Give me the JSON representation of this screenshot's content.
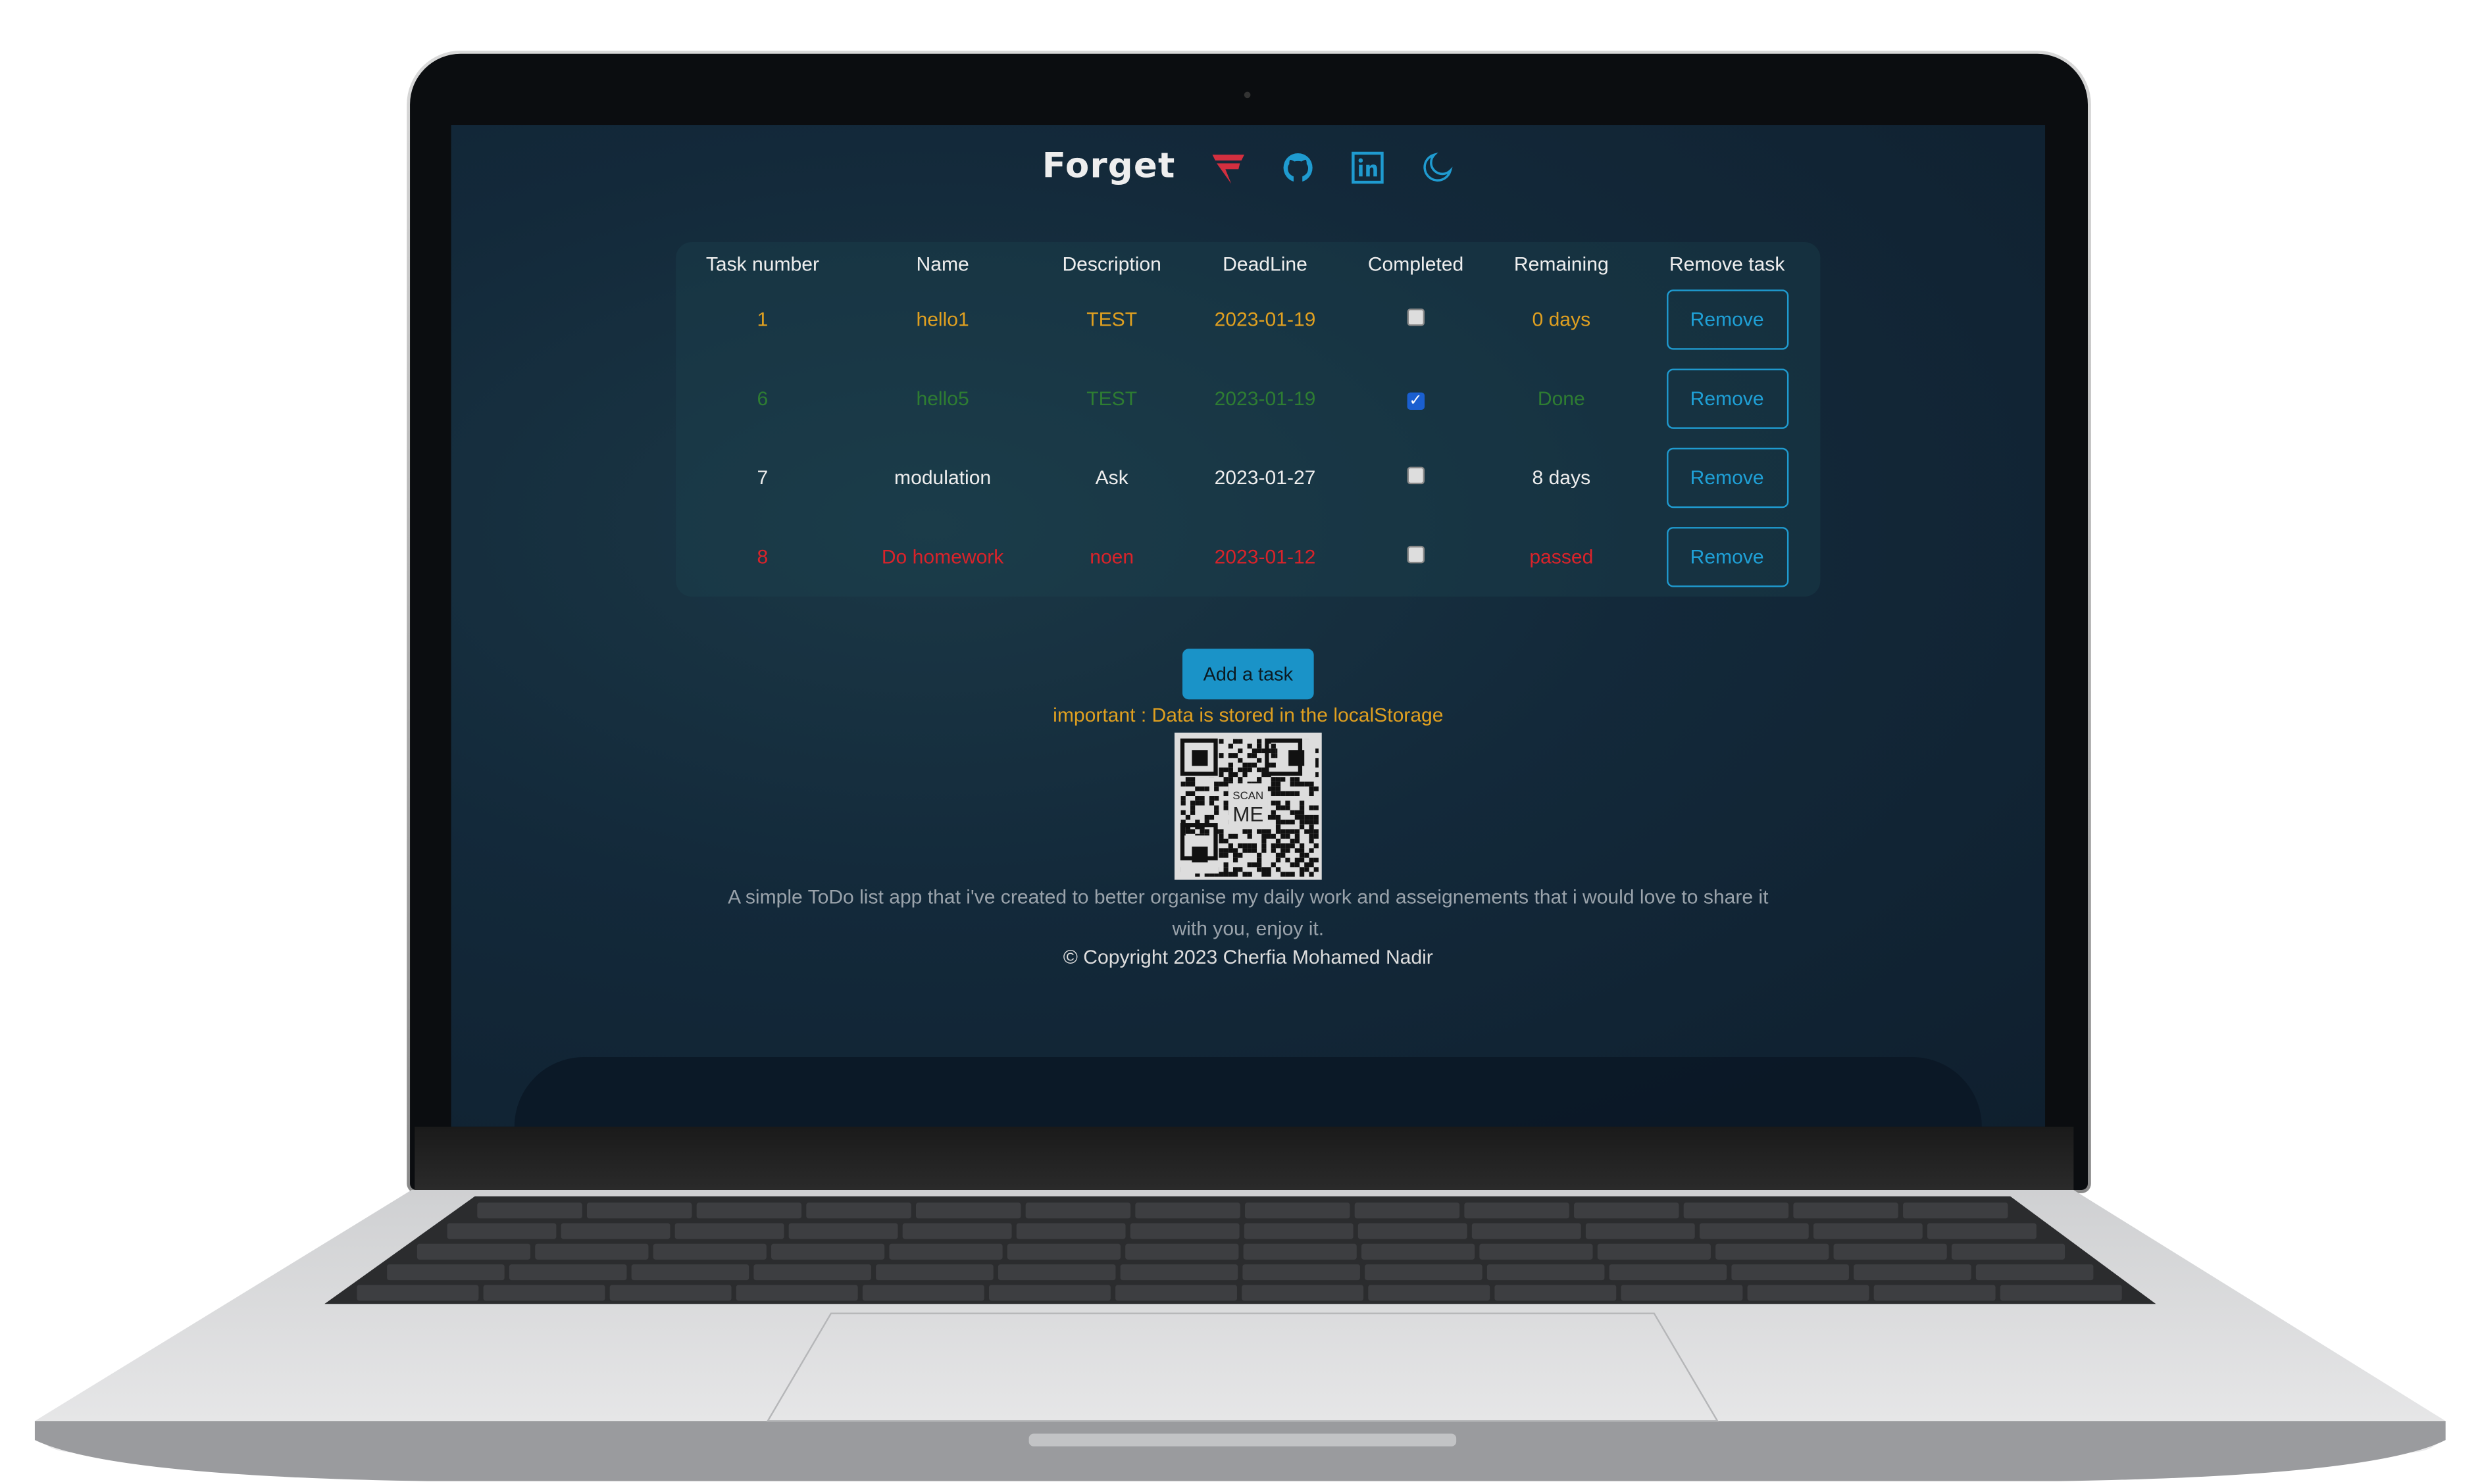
{
  "app": {
    "title": "Forget"
  },
  "header": {
    "icons": [
      "forget-logo-icon",
      "github-icon",
      "linkedin-icon",
      "moon-icon"
    ]
  },
  "table": {
    "columns": [
      "Task number",
      "Name",
      "Description",
      "DeadLine",
      "Completed",
      "Remaining",
      "Remove task"
    ],
    "rows": [
      {
        "number": "1",
        "name": "hello1",
        "description": "TEST",
        "deadline": "2023-01-19",
        "completed": false,
        "remaining": "0 days",
        "remove": "Remove",
        "color": "#e0a020"
      },
      {
        "number": "6",
        "name": "hello5",
        "description": "TEST",
        "deadline": "2023-01-19",
        "completed": true,
        "remaining": "Done",
        "remove": "Remove",
        "color": "#2e7d32"
      },
      {
        "number": "7",
        "name": "modulation",
        "description": "Ask",
        "deadline": "2023-01-27",
        "completed": false,
        "remaining": "8 days",
        "remove": "Remove",
        "color": "#eeeeee"
      },
      {
        "number": "8",
        "name": "Do homework",
        "description": "noen",
        "deadline": "2023-01-12",
        "completed": false,
        "remaining": "passed",
        "remove": "Remove",
        "color": "#d9232a"
      }
    ]
  },
  "actions": {
    "add_task": "Add a task"
  },
  "notice": "important : Data is stored in the localStorage",
  "qr": {
    "label_top": "SCAN",
    "label_bottom": "ME"
  },
  "footer": {
    "description": "A simple ToDo list app that i've created to better organise my daily work and asseignements that i would love to share it with you, enjoy it.",
    "copyright": "© Copyright 2023 Cherfia Mohamed Nadir"
  }
}
